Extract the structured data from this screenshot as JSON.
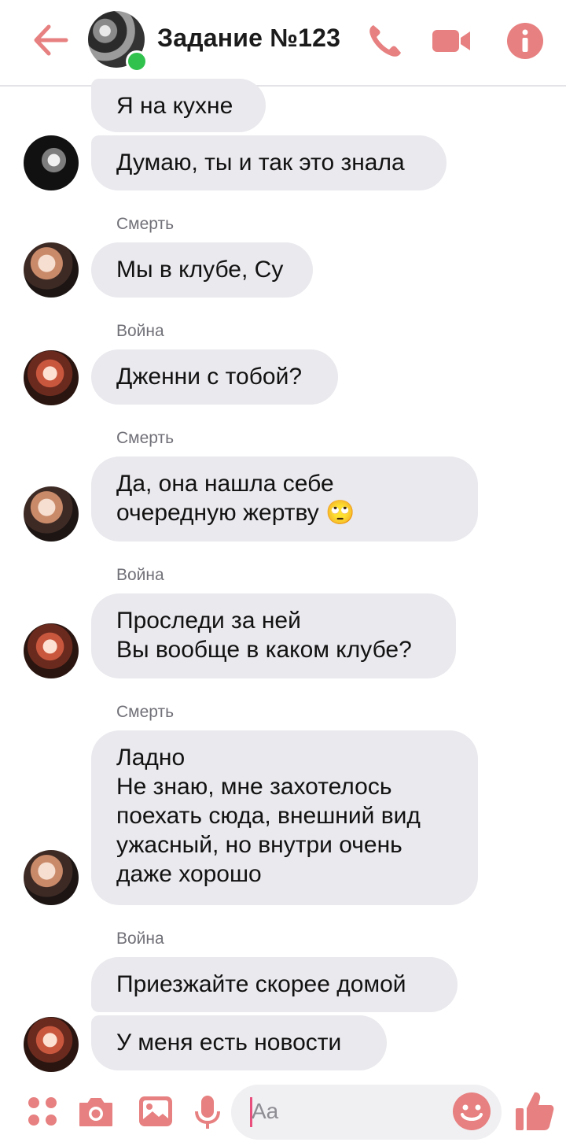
{
  "header": {
    "title": "Задание №123",
    "accent_color": "#e78080",
    "online_color": "#31c24d"
  },
  "messages": [
    {
      "sender": null,
      "text": "Я на кухне"
    },
    {
      "sender": null,
      "text": "Думаю, ты и так это знала"
    },
    {
      "sender": "Смерть",
      "text": "Мы в клубе, Су"
    },
    {
      "sender": "Война",
      "text": "Дженни с тобой?"
    },
    {
      "sender": "Смерть",
      "text": "Да, она нашла себе\nочередную жертву 🙄"
    },
    {
      "sender": "Война",
      "text": "Проследи за ней\nВы вообще в каком клубе?"
    },
    {
      "sender": "Смерть",
      "text": "Ладно\nНе знаю, мне захотелось\nпоехать сюда, внешний вид\nужасный, но внутри очень\nдаже хорошо"
    },
    {
      "sender": "Война",
      "text": "Приезжайте скорее домой"
    },
    {
      "sender": null,
      "text": "У меня есть новости"
    }
  ],
  "composer": {
    "placeholder": "Aa"
  }
}
